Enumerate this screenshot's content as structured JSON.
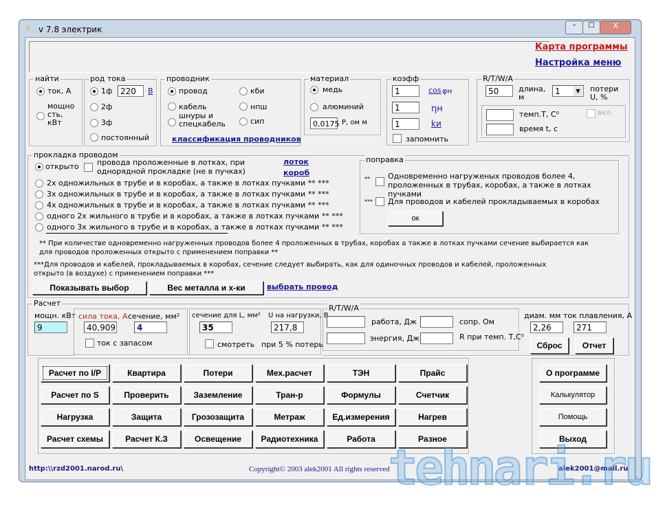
{
  "window": {
    "title": "v 7.8 электрик",
    "min": "–",
    "max": "□",
    "close": "X"
  },
  "top": {
    "map_link": "Карта программы",
    "menu_link": "Настройка меню"
  },
  "find": {
    "legend": "найти",
    "opt1": "ток, А",
    "opt2": "мощно сть, кВт"
  },
  "current_type": {
    "legend": "род тока",
    "opt1": "1ф",
    "voltage": "220",
    "volt_link": "В",
    "opt2": "2ф",
    "opt3": "3ф",
    "opt4": "постоянный"
  },
  "conductor": {
    "legend": "проводник",
    "opts": [
      "провод",
      "кабель",
      "шнуры и спецкабель",
      "кби",
      "нпш",
      "сип"
    ],
    "link": "классификация проводников"
  },
  "material": {
    "legend": "материал",
    "opt1": "медь",
    "opt2": "алюминий",
    "rho": "0,0175",
    "rho_label": "Р, ом м"
  },
  "coeff": {
    "legend": "коэфф",
    "v1": "1",
    "l1": "cos",
    "l1b": "φн",
    "v2": "1",
    "l2": "ηн",
    "v3": "1",
    "l3": "kи",
    "remember": "запомнить"
  },
  "rtwa": {
    "legend": "R/T/W/A",
    "length": "50",
    "length_label": "длина, м",
    "loss": "1",
    "loss_label": "потери U, %",
    "temp_label": "темп.T, C⁰",
    "time_label": "время t, c",
    "enable": "вкл."
  },
  "laying": {
    "legend": "прокладка проводом",
    "open": "открыто",
    "single_row": "провода проложенные в лотках, при однорядной прокладке (не в пучках)",
    "tray": "лоток",
    "box": "короб",
    "opts": [
      "2х одножильных в трубе и в коробах, а также в лотках пучками ** ***",
      "3х одножильных в трубе и в коробах, а также в лотках пучками ** ***",
      "4х одножильных в трубе и в коробах, а также в лотках пучками ** ***",
      "одного 2х жильного в трубе и в коробах, а также в лотках пучками ** ***",
      "одного 3х жильного в трубе и в коробах, а также в лотках пучками ** ***"
    ],
    "note1": "** При количестве одновременно нагруженных проводов более 4 проложенных в трубах, коробах а также в лотках пучками сечение выбирается как для проводов проложенных открыто с применением поправки **",
    "note2": "***Для проводов и кабелей, прокладываемых в коробах, сечение следует выбирать, как для одиночных проводов и кабелей, проложенных открыто (в воздухе) с применением поправки ***",
    "show_btn": "Показывать выбор",
    "weight_btn": "Вес металла и х-ки",
    "choose_link": "выбрать провод"
  },
  "correction": {
    "legend": "поправка",
    "m1": "**",
    "c1": "Одновременно нагруженых проводов более 4, проложенных в трубах, коробах, а также в лотках пучками",
    "m2": "***",
    "c2": "Для проводов и кабелей прокладываемых в коробах",
    "ok": "ок"
  },
  "calc": {
    "legend": "Расчет",
    "power_label": "мощн. кВт",
    "power": "9",
    "current_label": "сила тока, А",
    "current": "40,909",
    "section_label": "сечение, мм²",
    "section": "4",
    "reserve": "ток с запасом",
    "sectL_label": "сечение для L, мм²",
    "sectL": "35",
    "uload_label": "U на нагрузки, В",
    "uload": "217,8",
    "view": "смотреть",
    "loss_note": "при 5 % потерь",
    "rtwa_legend": "R/T/W/A",
    "work": "работа, Дж",
    "energy": "энергия, Дж",
    "resist": "сопр. Ом",
    "rtemp": "R при темп. T,C⁰",
    "diam_label": "диам. мм",
    "diam": "2,26",
    "melt_label": "ток плавления, А",
    "melt": "271",
    "reset": "Сброс",
    "report": "Отчет"
  },
  "buttons": [
    [
      "Расчет по I/P",
      "Квартира",
      "Потери",
      "Мех.расчет",
      "ТЭН",
      "Прайс"
    ],
    [
      "Расчет по S",
      "Проверить",
      "Заземление",
      "Тран-р",
      "Формулы",
      "Счетчик"
    ],
    [
      "Нагрузка",
      "Защита",
      "Грозозащита",
      "Метраж",
      "Ед.измерения",
      "Нагрев"
    ],
    [
      "Расчет схемы",
      "Расчет К.З",
      "Освещение",
      "Радиотехника",
      "Работа",
      "Разное"
    ]
  ],
  "side_buttons": [
    "О программе",
    "Калькулятор",
    "Помощь",
    "Выход"
  ],
  "footer": {
    "url": "http:\\\\rzd2001.narod.ru\\",
    "copyright": "Copyright© 2003 alek2001 All rights reserved",
    "email": "alek2001@mail.ru"
  },
  "watermark": "tehnari.ru"
}
